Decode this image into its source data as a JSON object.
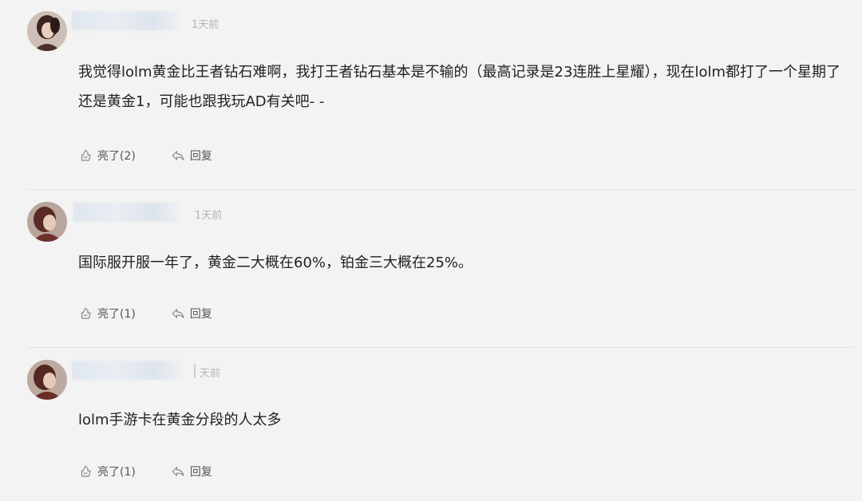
{
  "comments": [
    {
      "time": "1天前",
      "text": "我觉得lolm黄金比王者钻石难啊，我打王者钻石基本是不输的（最高记录是23连胜上星耀），现在lolm都打了一个星期了还是黄金1，可能也跟我玩AD有关吧- -",
      "like_label": "亮了(2)",
      "reply_label": "回复"
    },
    {
      "time": "1天前",
      "text": "国际服开服一年了，黄金二大概在60%，铂金三大概在25%。",
      "like_label": "亮了(1)",
      "reply_label": "回复"
    },
    {
      "time": "天前",
      "text": "lolm手游卡在黄金分段的人太多",
      "like_label": "亮了(1)",
      "reply_label": "回复"
    }
  ],
  "icons": {
    "like": "thumbs-up-icon",
    "reply": "reply-icon"
  },
  "colors": {
    "background": "#f3f3f3",
    "text": "#222222",
    "muted": "#b5b5b5",
    "action": "#555555"
  }
}
